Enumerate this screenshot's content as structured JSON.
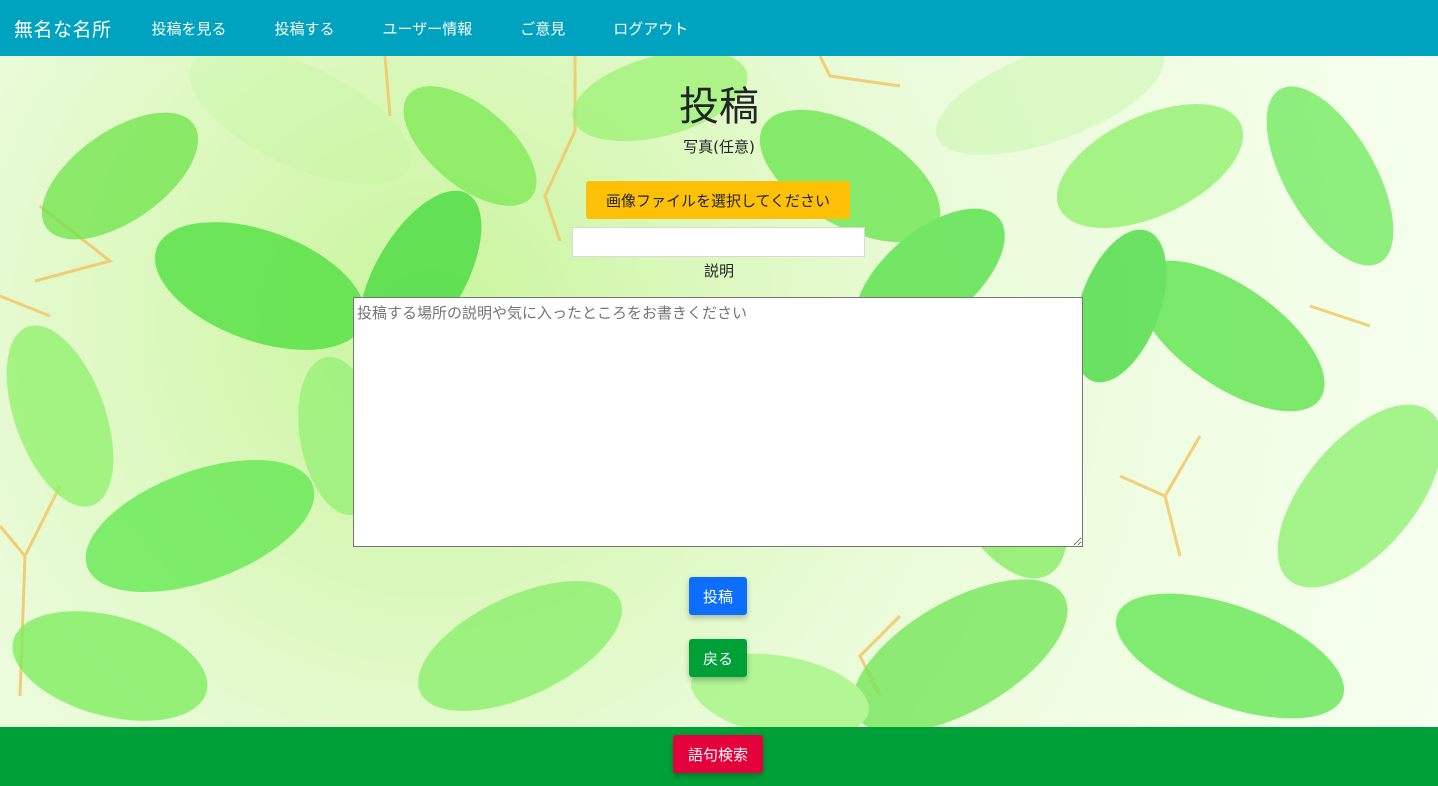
{
  "navbar": {
    "brand": "無名な名所",
    "links": [
      "投稿を見る",
      "投稿する",
      "ユーザー情報",
      "ご意見",
      "ログアウト"
    ]
  },
  "form": {
    "title": "投稿",
    "photo_label": "写真(任意)",
    "file_button_label": "画像ファイルを選択してください",
    "description_label": "説明",
    "description_placeholder": "投稿する場所の説明や気に入ったところをお書きください",
    "description_value": "",
    "submit_label": "投稿",
    "back_label": "戻る"
  },
  "footer": {
    "search_label": "語句検索"
  },
  "colors": {
    "navbar": "#00a3bf",
    "footer": "#00a038",
    "file_button": "#ffc107",
    "submit_button": "#0d6efd",
    "back_button": "#00a038",
    "search_button": "#e4003b"
  }
}
